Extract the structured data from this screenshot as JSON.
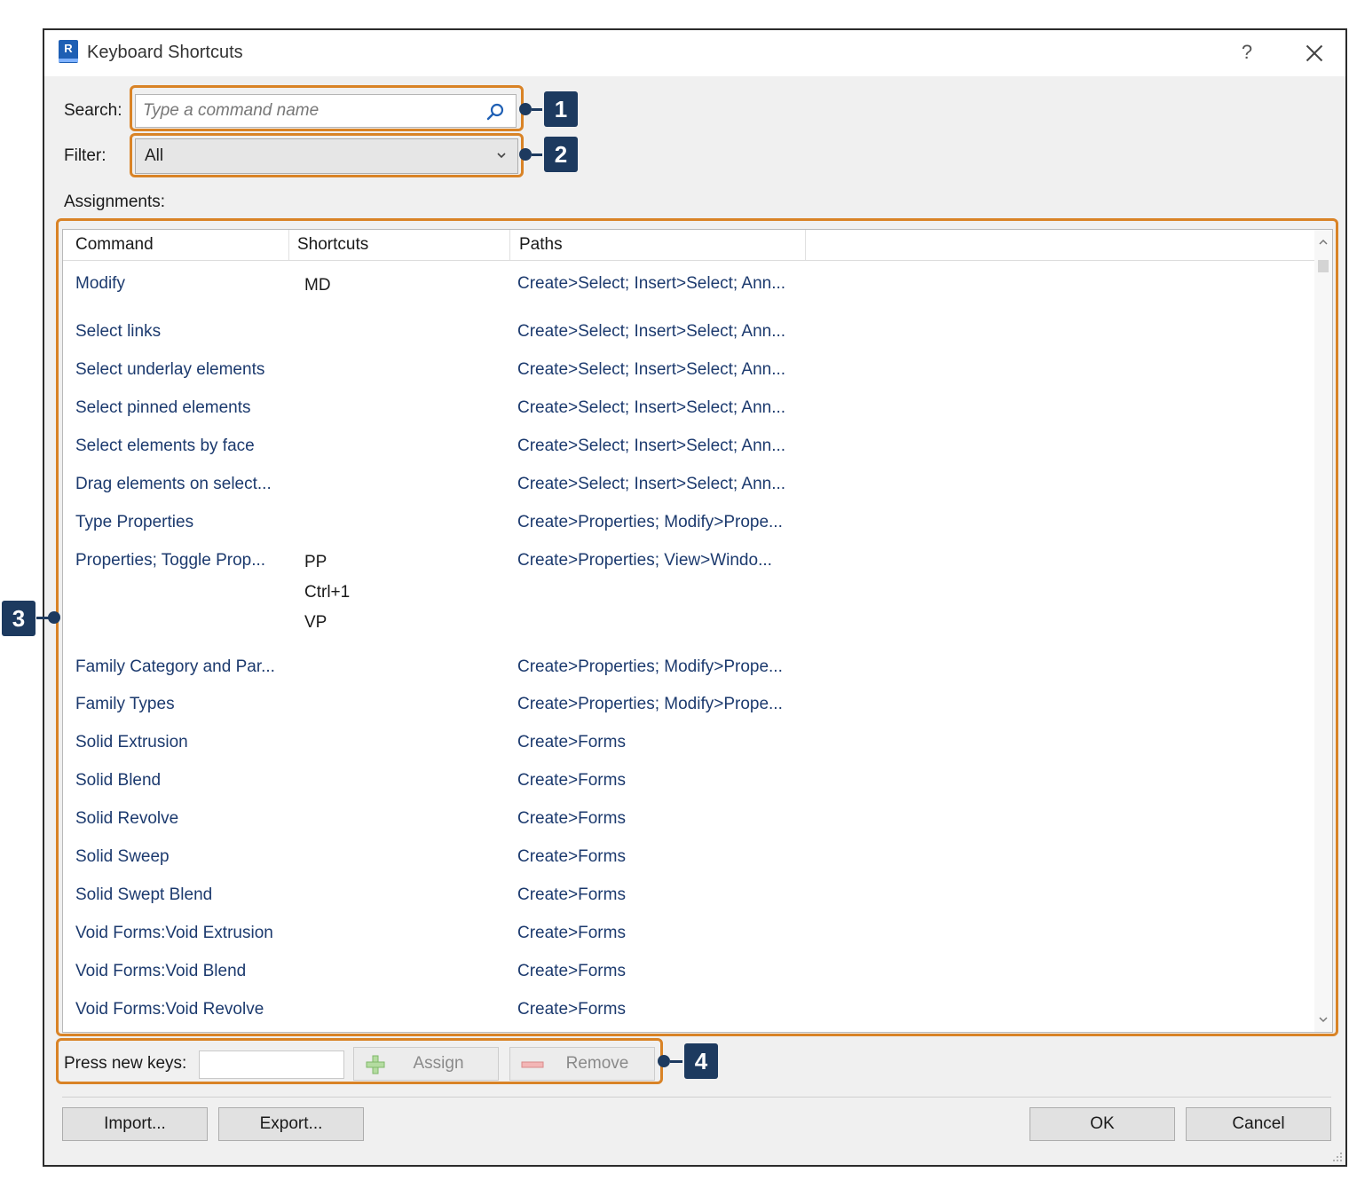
{
  "dialog": {
    "title": "Keyboard Shortcuts",
    "help_label": "?",
    "app_icon_letter": "R"
  },
  "search": {
    "label": "Search:",
    "placeholder": "Type a command name",
    "value": ""
  },
  "filter": {
    "label": "Filter:",
    "value": "All"
  },
  "assignments_label": "Assignments:",
  "table": {
    "columns": [
      "Command",
      "Shortcuts",
      "Paths"
    ],
    "rows": [
      {
        "command": "Modify",
        "shortcuts": [
          "MD"
        ],
        "path": "Create>Select; Insert>Select; Ann..."
      },
      {
        "command": "Select links",
        "shortcuts": [],
        "path": "Create>Select; Insert>Select; Ann..."
      },
      {
        "command": "Select underlay elements",
        "shortcuts": [],
        "path": "Create>Select; Insert>Select; Ann..."
      },
      {
        "command": "Select pinned elements",
        "shortcuts": [],
        "path": "Create>Select; Insert>Select; Ann..."
      },
      {
        "command": "Select elements by face",
        "shortcuts": [],
        "path": "Create>Select; Insert>Select; Ann..."
      },
      {
        "command": "Drag elements on select...",
        "shortcuts": [],
        "path": "Create>Select; Insert>Select; Ann..."
      },
      {
        "command": "Type Properties",
        "shortcuts": [],
        "path": "Create>Properties; Modify>Prope..."
      },
      {
        "command": "Properties; Toggle Prop...",
        "shortcuts": [
          "PP",
          "Ctrl+1",
          "VP"
        ],
        "path": "Create>Properties; View>Windo..."
      },
      {
        "command": "Family Category and Par...",
        "shortcuts": [],
        "path": "Create>Properties; Modify>Prope..."
      },
      {
        "command": "Family Types",
        "shortcuts": [],
        "path": "Create>Properties; Modify>Prope..."
      },
      {
        "command": "Solid Extrusion",
        "shortcuts": [],
        "path": "Create>Forms"
      },
      {
        "command": "Solid Blend",
        "shortcuts": [],
        "path": "Create>Forms"
      },
      {
        "command": "Solid Revolve",
        "shortcuts": [],
        "path": "Create>Forms"
      },
      {
        "command": "Solid Sweep",
        "shortcuts": [],
        "path": "Create>Forms"
      },
      {
        "command": "Solid Swept Blend",
        "shortcuts": [],
        "path": "Create>Forms"
      },
      {
        "command": "Void Forms:Void Extrusion",
        "shortcuts": [],
        "path": "Create>Forms"
      },
      {
        "command": "Void Forms:Void Blend",
        "shortcuts": [],
        "path": "Create>Forms"
      },
      {
        "command": "Void Forms:Void Revolve",
        "shortcuts": [],
        "path": "Create>Forms"
      }
    ]
  },
  "keys": {
    "label": "Press new keys:",
    "value": "",
    "assign_label": "Assign",
    "remove_label": "Remove"
  },
  "footer": {
    "import_label": "Import...",
    "export_label": "Export...",
    "ok_label": "OK",
    "cancel_label": "Cancel"
  },
  "callouts": [
    "1",
    "2",
    "3",
    "4"
  ],
  "colors": {
    "highlight": "#d98326",
    "callout": "#1d3a5f",
    "link_text": "#1c3a6e",
    "app_icon": "#1e5fb4"
  },
  "icons": [
    "app-icon",
    "help-icon",
    "close-icon",
    "search-icon",
    "chevron-down-icon",
    "plus-icon",
    "minus-icon",
    "scroll-up-icon",
    "scroll-down-icon",
    "resize-grip-icon"
  ]
}
